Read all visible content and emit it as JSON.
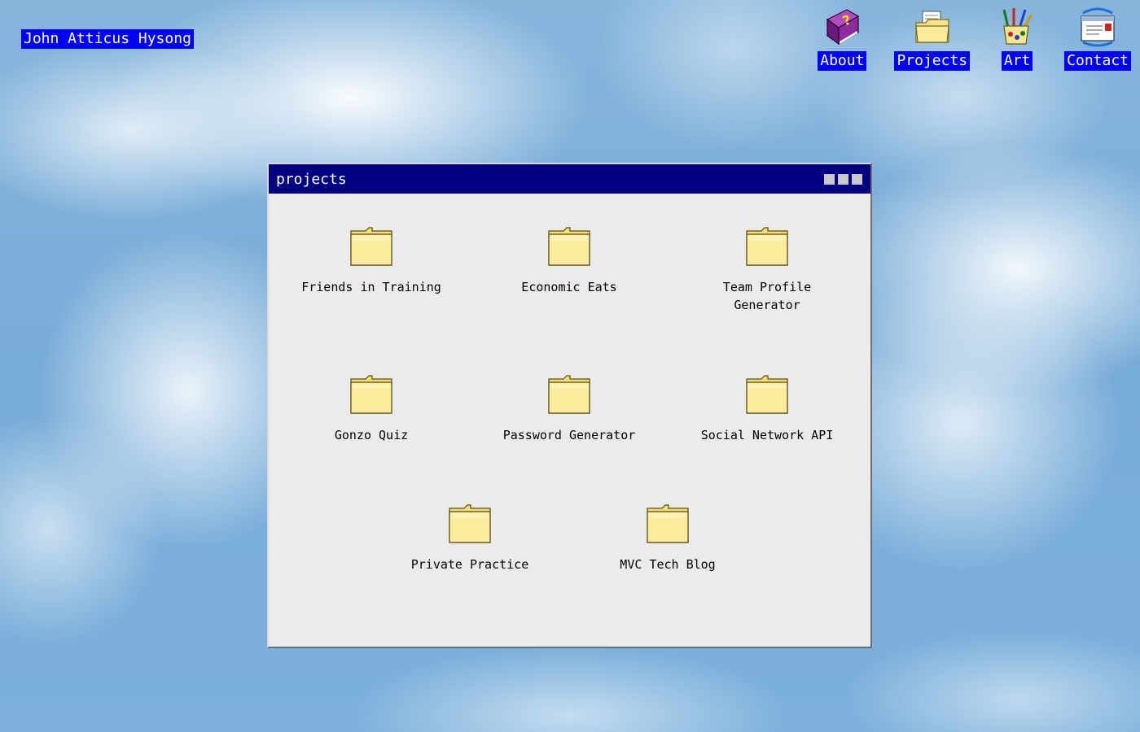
{
  "owner_name": "John Atticus Hysong",
  "nav": {
    "items": [
      {
        "label": "About",
        "icon": "help-book-icon"
      },
      {
        "label": "Projects",
        "icon": "folder-with-files-icon"
      },
      {
        "label": "Art",
        "icon": "paint-cup-icon"
      },
      {
        "label": "Contact",
        "icon": "mail-letter-icon"
      }
    ]
  },
  "window": {
    "title": "projects",
    "folders": [
      {
        "label": "Friends in Training"
      },
      {
        "label": "Economic Eats"
      },
      {
        "label": "Team Profile Generator"
      },
      {
        "label": "Gonzo Quiz"
      },
      {
        "label": "Password Generator"
      },
      {
        "label": "Social Network API"
      },
      {
        "label": "Private Practice"
      },
      {
        "label": "MVC Tech Blog"
      }
    ]
  },
  "colors": {
    "label_background": "#0000ff",
    "titlebar": "#000080",
    "window_body": "#ebebeb",
    "folder_fill": "#fbec9b"
  }
}
